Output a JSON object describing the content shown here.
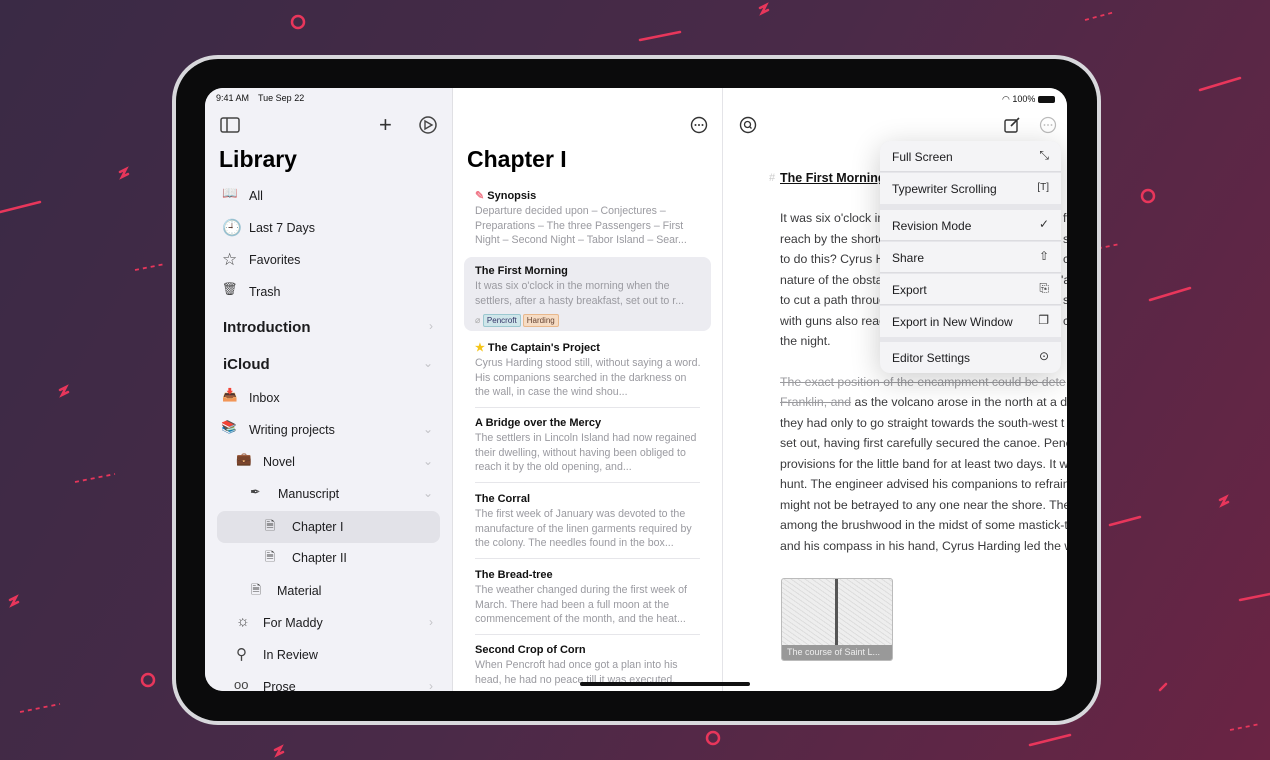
{
  "colors": {
    "background": "#4a2a48",
    "accent_squiggle": "#e8365b",
    "sidebar_bg": "#f2f2f7",
    "selection": "#e4e4ea",
    "tag_pencroft": "#cfe6ea",
    "tag_harding": "#f6dcc4",
    "star": "#f5c518"
  },
  "status": {
    "time": "9:41 AM",
    "date": "Tue Sep 22",
    "battery": "100%"
  },
  "sidebar": {
    "title": "Library",
    "toolbar": {
      "toggle_icon": "sidebar-icon",
      "add_icon": "plus-icon",
      "settings_icon": "gear-icon"
    },
    "items": [
      {
        "label": "All",
        "icon": "book-icon"
      },
      {
        "label": "Last 7 Days",
        "icon": "clock-icon"
      },
      {
        "label": "Favorites",
        "icon": "star-icon"
      },
      {
        "label": "Trash",
        "icon": "trash-icon"
      }
    ],
    "sections": [
      {
        "label": "Introduction",
        "chevron": "right"
      },
      {
        "label": "iCloud",
        "chevron": "down"
      }
    ],
    "tree": [
      {
        "label": "Inbox",
        "icon": "inbox-icon"
      },
      {
        "label": "Writing projects",
        "icon": "books-icon",
        "chevron": "down"
      },
      {
        "label": "Novel",
        "icon": "briefcase-icon",
        "chevron": "down"
      },
      {
        "label": "Manuscript",
        "icon": "pen-icon",
        "chevron": "down"
      },
      {
        "label": "Chapter I",
        "icon": "document-icon",
        "selected": true
      },
      {
        "label": "Chapter II",
        "icon": "document-icon"
      },
      {
        "label": "Material",
        "icon": "document-icon"
      },
      {
        "label": "For Maddy",
        "icon": "sun-icon",
        "chevron": "right"
      },
      {
        "label": "In Review",
        "icon": "search-icon"
      },
      {
        "label": "Prose",
        "icon": "glasses-icon",
        "chevron": "right"
      }
    ]
  },
  "list": {
    "title": "Chapter I",
    "more_icon": "ellipsis-icon",
    "sheets": [
      {
        "title": "Synopsis",
        "marker": "pink-flag",
        "snippet": "Departure decided upon – Conjectures – Preparations – The three Passengers – First Night – Second Night – Tabor Island – Sear..."
      },
      {
        "title": "The First Morning",
        "snippet": "It was six o'clock in the morning when the settlers, after a hasty breakfast, set out to r...",
        "selected": true,
        "tags": [
          "Pencroft",
          "Harding"
        ]
      },
      {
        "title": "The Captain's Project",
        "marker": "star",
        "snippet": "Cyrus Harding stood still, without saying a word. His companions searched in the darkness on the wall, in case the wind shou..."
      },
      {
        "title": "A Bridge over the Mercy",
        "snippet": "The settlers in Lincoln Island had now regained their dwelling, without having been obliged to reach it by the old opening, and..."
      },
      {
        "title": "The Corral",
        "snippet": "The first week of January was devoted to the manufacture of the linen garments required by the colony. The needles found in the box..."
      },
      {
        "title": "The Bread-tree",
        "snippet": "The weather changed during the first week of March. There had been a full moon at the commencement of the month, and the heat..."
      },
      {
        "title": "Second Crop of Corn",
        "snippet": "When Pencroft had once got a plan into his head, he had no peace till it was executed."
      }
    ]
  },
  "editor": {
    "heading_marker": "#",
    "heading": "The First Morning",
    "para1": [
      {
        "left": "It was six o'clock in",
        "right": "ft"
      },
      {
        "left": "reach by the shorte",
        "right": "sl"
      },
      {
        "left": "to do this? Cyrus Ha",
        "right": "c"
      },
      {
        "left": "nature of the obstac",
        "right": "'a"
      },
      {
        "left": "to cut a path throug",
        "right": "s"
      },
      {
        "left": "with guns also read",
        "right": "c"
      },
      {
        "left": "the night.",
        "right": ""
      }
    ],
    "deleted1": "The exact position of the encampment could be dete",
    "deleted2": "Franklin, and",
    "para2_first": " as the volcano arose in the north at a d",
    "para2": [
      "they had only to go straight towards the south-west t",
      "set out, having first carefully secured the canoe. Penc",
      "provisions for the little band for at least two days. It w",
      "hunt. The engineer advised his companions to refrain",
      "might not be betrayed to any one near the shore. The",
      "among the brushwood in the midst of some mastick-t",
      "and his compass in his hand, Cyrus Harding led the w"
    ],
    "image_caption": "The course of Saint L...",
    "toolbar": {
      "search_icon": "search-icon",
      "compose_icon": "compose-icon",
      "more_icon": "ellipsis-icon"
    }
  },
  "menu": {
    "items": [
      {
        "label": "Full Screen",
        "icon": "expand-icon",
        "glyph": "⤡"
      },
      {
        "label": "Typewriter Scrolling",
        "icon": "typewriter-icon",
        "glyph": "[T]"
      },
      {
        "label": "Revision Mode",
        "icon": "checkmark-seal-icon",
        "glyph": "✓"
      },
      {
        "label": "Share",
        "icon": "share-icon",
        "glyph": "⇧"
      },
      {
        "label": "Export",
        "icon": "export-icon",
        "glyph": "⎘"
      },
      {
        "label": "Export in New Window",
        "icon": "export-window-icon",
        "glyph": "❐"
      },
      {
        "label": "Editor Settings",
        "icon": "settings-icon",
        "glyph": "⊙"
      }
    ]
  }
}
